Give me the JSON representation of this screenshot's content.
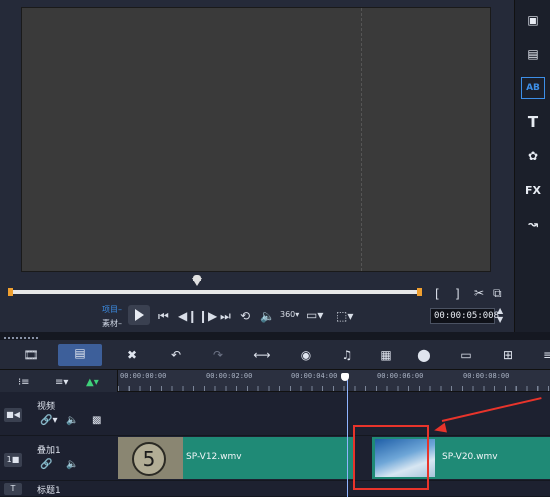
{
  "player": {
    "mode_project": "项目",
    "mode_clip": "素材",
    "timecode": "00:00:05:008",
    "mark_in": "[",
    "mark_out": "]"
  },
  "timeline": {
    "ruler_ticks": [
      "00:00:00:00",
      "00:00:02:00",
      "00:00:04:00",
      "00:00:06:00",
      "00:00:08:00"
    ],
    "tracks": [
      {
        "name": "视频"
      },
      {
        "name": "叠加1"
      },
      {
        "name": "标题1"
      }
    ],
    "clips": [
      {
        "label": "SP-V12.wmv",
        "thumb_number": "5"
      },
      {
        "label": "SP-V20.wmv"
      }
    ]
  },
  "right_strip": {
    "title_btn": "T",
    "fx_btn": "FX"
  },
  "colors": {
    "accent": "#3d8fe8",
    "clip": "#1f8a76",
    "annotation": "#e8342b"
  }
}
